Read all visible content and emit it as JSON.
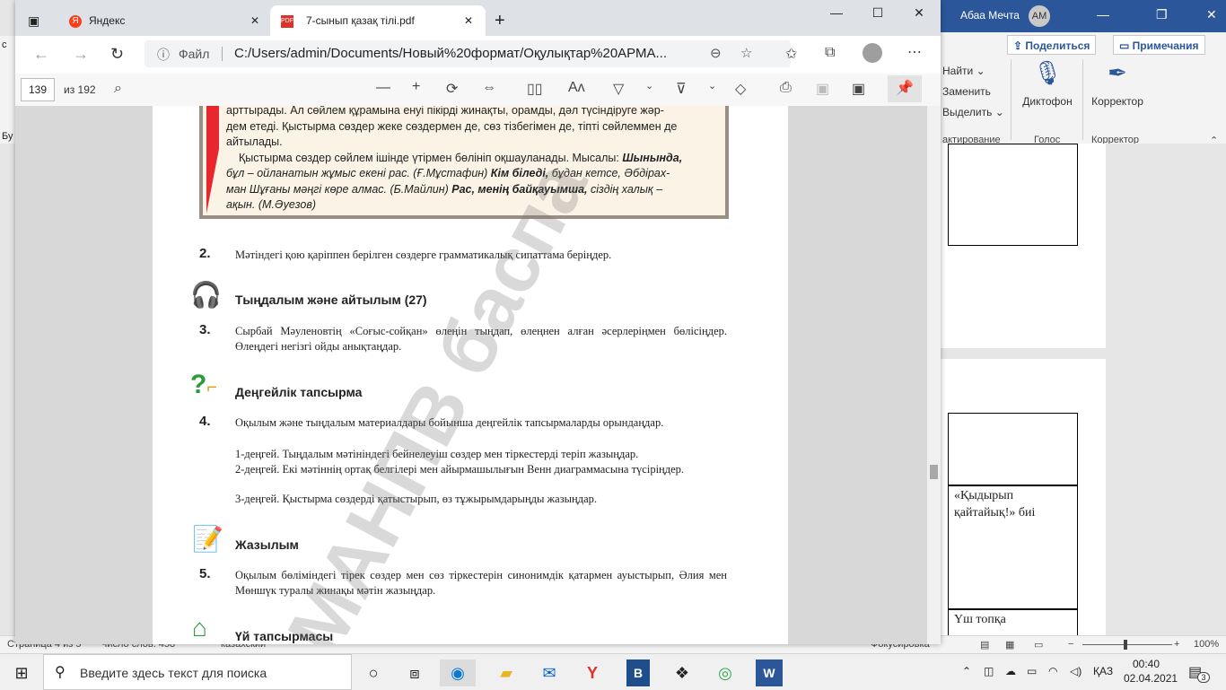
{
  "word": {
    "user_name": "Абаа Мечта",
    "avatar": "AM",
    "share": "Поделиться",
    "notes": "Примечания",
    "find": "Найти",
    "replace": "Заменить",
    "select": "Выделить",
    "dictophone": "Диктофон",
    "corrector": "Корректор",
    "group_edit": "актирование",
    "group_voice": "Голос",
    "group_corrector": "Корректор",
    "cell_text_1": "«Қыдырып қайтайық!» биі",
    "cell_text_2": "Үш топқа",
    "left_edge_1": "c",
    "left_edge_2": "Бу",
    "status_page": "Страница 4 из 5",
    "status_words": "Число слов: 458",
    "status_lang": "казахский",
    "status_focus": "Фокусировка",
    "zoom": "100%"
  },
  "browser": {
    "tabs": [
      {
        "label": "Яндекс"
      },
      {
        "label": "7-сынып қазақ тілі.pdf"
      }
    ],
    "address_prefix": "Файл",
    "url": "C:/Users/admin/Documents/Новый%20формат/Оқулықтар%20АРМА..."
  },
  "pdf": {
    "current_page": "139",
    "total_pages": "из 192"
  },
  "content": {
    "box_line1": "арттырады. Ал сөйлем құрамына енуі пікірді жинақты, орамды, дәл түсіндіруге жәр-",
    "box_line2": "дем етеді. Қыстырма сөздер жеке сөздермен де, сөз тізбегімен де, тіпті сөйлеммен де",
    "box_line3": "айтылады.",
    "box_line4": "Қыстырма сөздер сөйлем ішінде үтірмен бөлініп оқшауланады. Мысалы:",
    "box_ex1_b": "Шынында,",
    "box_ex1": " бұл – ойланатын жұмыс екені рас. (Ғ.Мұстафин) ",
    "box_ex2_b": "Кім біледі,",
    "box_ex2": " бұдан кетсе, Әбдірах-",
    "box_line6": "ман Шұғаны мәңгі көре алмас. (Б.Майлин) ",
    "box_ex3_b": "Рас, менің байқауымша,",
    "box_ex3": " сіздің халық –",
    "box_line7": "ақын. (М.Әуезов)",
    "task2_num": "2.",
    "task2": "Мәтіндегі қою қаріппен берілген сөздерге грамматикалық сипаттама беріңдер.",
    "head_listen": "Тыңдалым және айтылым (27)",
    "task3_num": "3.",
    "task3": "Сырбай Мәуленовтің «Соғыс-сойқан» өлеңін тыңдап, өлеңнен алған әсерлеріңмен бөлісіңдер. Өлеңдегі негізгі ойды анықтаңдар.",
    "head_level": "Деңгейлік тапсырма",
    "task4_num": "4.",
    "task4": "Оқылым және тыңдалым материалдары бойынша деңгейлік тапсырмаларды орындаңдар.",
    "task4_l1": "1-деңгей. Тыңдалым мәтініндегі бейнелеуіш сөздер мен тіркестерді теріп жазыңдар.",
    "task4_l2": "2-деңгей. Екі мәтіннің ортақ белгілері мен айырмашылығын Венн диаграммасына түсіріңдер.",
    "task4_l3": "3-деңгей. Қыстырма сөздерді қатыстырып, өз тұжырымдарыңды жазыңдар.",
    "head_write": "Жазылым",
    "task5_num": "5.",
    "task5": "Оқылым бөліміндегі тірек сөздер мен сөз тіркестерін синонимдік қатармен ауыстырып, Әлия мен Мөншүк туралы жинақы мәтін жазыңдар.",
    "head_home": "Үй тапсырмасы",
    "watermark": "МАНПВ баспа"
  },
  "taskbar": {
    "search_placeholder": "Введите здесь текст для поиска",
    "lang": "ҚАЗ",
    "time": "00:40",
    "date": "02.04.2021",
    "notif": "3"
  }
}
